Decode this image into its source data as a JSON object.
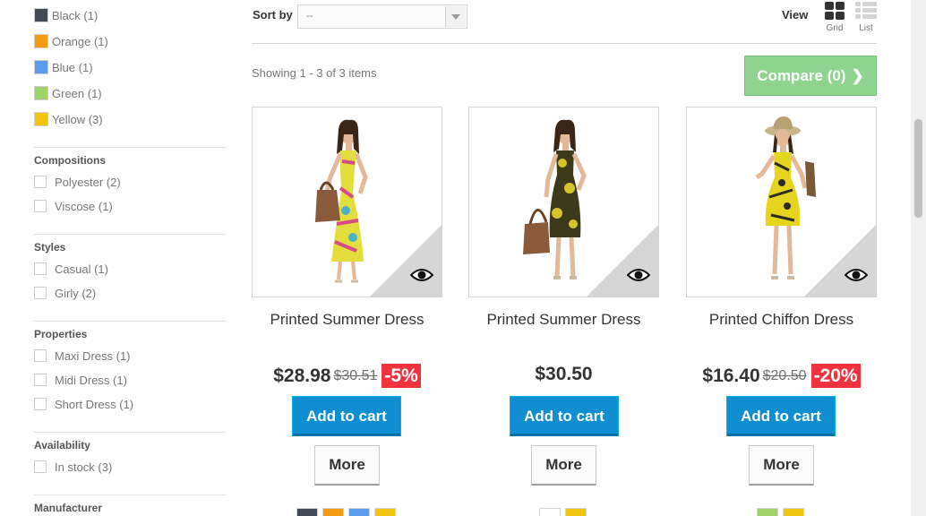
{
  "sidebar": {
    "colors": [
      {
        "label": "Black (1)",
        "color": "#434a54"
      },
      {
        "label": "Orange (1)",
        "color": "#f39c11"
      },
      {
        "label": "Blue (1)",
        "color": "#5d9cec"
      },
      {
        "label": "Green (1)",
        "color": "#a0d468"
      },
      {
        "label": "Yellow (3)",
        "color": "#f1c40f"
      }
    ],
    "compositions": {
      "title": "Compositions",
      "options": [
        "Polyester (2)",
        "Viscose (1)"
      ]
    },
    "styles": {
      "title": "Styles",
      "options": [
        "Casual (1)",
        "Girly (2)"
      ]
    },
    "properties": {
      "title": "Properties",
      "options": [
        "Maxi Dress (1)",
        "Midi Dress (1)",
        "Short Dress (1)"
      ]
    },
    "availability": {
      "title": "Availability",
      "options": [
        "In stock (3)"
      ]
    },
    "manufacturer": {
      "title": "Manufacturer"
    }
  },
  "toolbar": {
    "sort_label": "Sort by",
    "sort_value": "--",
    "view_label": "View",
    "grid_label": "Grid",
    "list_label": "List",
    "showing": "Showing 1 - 3 of 3 items",
    "compare_label": "Compare (0)"
  },
  "products": [
    {
      "name": "Printed Summer Dress",
      "price": "$28.98",
      "old_price": "$30.51",
      "discount": "-5%",
      "cart_label": "Add to cart",
      "more_label": "More",
      "swatches": [
        "#434a54",
        "#f39c11",
        "#5d9cec",
        "#f1c40f"
      ]
    },
    {
      "name": "Printed Summer Dress",
      "price": "$30.50",
      "old_price": "",
      "discount": "",
      "cart_label": "Add to cart",
      "more_label": "More",
      "swatches": [
        "#ffffff",
        "#f1c40f"
      ]
    },
    {
      "name": "Printed Chiffon Dress",
      "price": "$16.40",
      "old_price": "$20.50",
      "discount": "-20%",
      "cart_label": "Add to cart",
      "more_label": "More",
      "swatches": [
        "#a0d468",
        "#f1c40f"
      ]
    }
  ]
}
